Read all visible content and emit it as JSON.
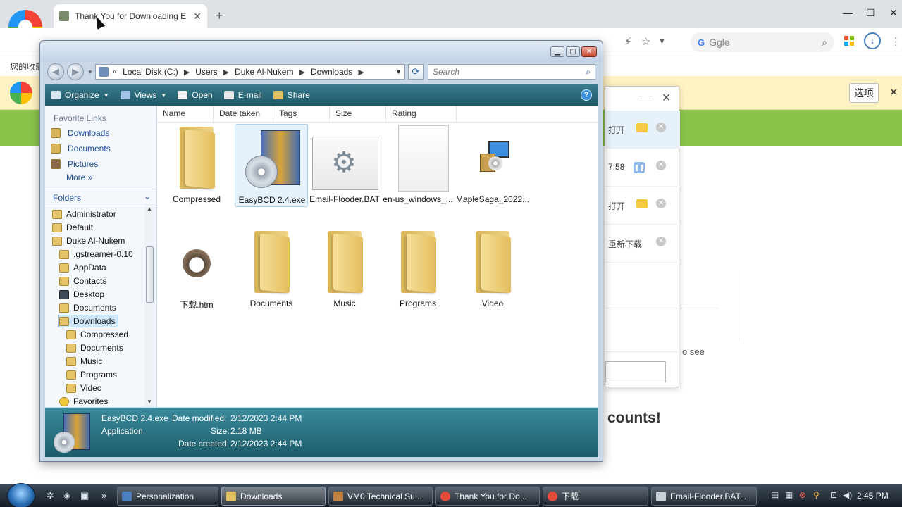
{
  "browser": {
    "tab_title": "Thank You for Downloading E",
    "tab_close": "✕",
    "new_tab": "+",
    "window_controls": {
      "min": "—",
      "max": "☐",
      "close": "✕"
    },
    "search_engine": "G",
    "search_placeholder": "Ggle",
    "bookmarks_text": "您的收藏",
    "infobar_button": "选项",
    "infobar_close": "✕",
    "page_heading": "counts!",
    "page_see": "o see",
    "download_panel": {
      "rows": [
        {
          "label": "打开",
          "action": "folder"
        },
        {
          "label": "7:58",
          "action": "pause"
        },
        {
          "label": "打开",
          "action": "folder"
        },
        {
          "label": "重新下载",
          "action": "none"
        }
      ]
    }
  },
  "explorer": {
    "nav": {
      "back": "◀",
      "forward": "▶"
    },
    "address": {
      "prefix": "«",
      "crumbs": [
        "Local Disk (C:)",
        "Users",
        "Duke Al-Nukem",
        "Downloads"
      ]
    },
    "search_placeholder": "Search",
    "commands": [
      {
        "label": "Organize",
        "icon": "organize-icon",
        "dropdown": true,
        "color": "#d8e6f2"
      },
      {
        "label": "Views",
        "icon": "views-icon",
        "dropdown": true,
        "color": "#9fc2e6"
      },
      {
        "label": "Open",
        "icon": "open-icon",
        "dropdown": false,
        "color": "#f3f3f3"
      },
      {
        "label": "E-mail",
        "icon": "email-icon",
        "dropdown": false,
        "color": "#e9e9e9"
      },
      {
        "label": "Share",
        "icon": "share-icon",
        "dropdown": false,
        "color": "#e0c060"
      }
    ],
    "help": "?",
    "favorite_links": {
      "title": "Favorite Links",
      "items": [
        "Downloads",
        "Documents",
        "Pictures"
      ],
      "more": "More  »"
    },
    "folders": {
      "title": "Folders",
      "tree": [
        {
          "label": "Administrator",
          "level": 1
        },
        {
          "label": "Default",
          "level": 1
        },
        {
          "label": "Duke Al-Nukem",
          "level": 1
        },
        {
          "label": ".gstreamer-0.10",
          "level": 2
        },
        {
          "label": "AppData",
          "level": 2
        },
        {
          "label": "Contacts",
          "level": 2
        },
        {
          "label": "Desktop",
          "level": 2
        },
        {
          "label": "Documents",
          "level": 2
        },
        {
          "label": "Downloads",
          "level": 2,
          "selected": true
        },
        {
          "label": "Compressed",
          "level": 3
        },
        {
          "label": "Documents",
          "level": 3
        },
        {
          "label": "Music",
          "level": 3
        },
        {
          "label": "Programs",
          "level": 3
        },
        {
          "label": "Video",
          "level": 3
        },
        {
          "label": "Favorites",
          "level": 2
        }
      ]
    },
    "columns": [
      "Name",
      "Date taken",
      "Tags",
      "Size",
      "Rating"
    ],
    "items": [
      {
        "label": "Compressed",
        "type": "folder"
      },
      {
        "label": "EasyBCD 2.4.exe",
        "type": "exe",
        "selected": true
      },
      {
        "label": "Email-Flooder.BAT",
        "type": "bat"
      },
      {
        "label": "en-us_windows_...",
        "type": "file"
      },
      {
        "label": "MapleSaga_2022...",
        "type": "setup"
      },
      {
        "label": "下载.htm",
        "type": "htm"
      },
      {
        "label": "Documents",
        "type": "folder"
      },
      {
        "label": "Music",
        "type": "folder"
      },
      {
        "label": "Programs",
        "type": "folder"
      },
      {
        "label": "Video",
        "type": "folder"
      }
    ],
    "details": {
      "name": "EasyBCD 2.4.exe",
      "type": "Application",
      "date_modified_label": "Date modified:",
      "date_modified": "2/12/2023 2:44 PM",
      "size_label": "Size:",
      "size": "2.18 MB",
      "date_created_label": "Date created:",
      "date_created": "2/12/2023 2:44 PM"
    }
  },
  "taskbar": {
    "buttons": [
      {
        "label": "Personalization",
        "color": "#4a7fc0"
      },
      {
        "label": "Downloads",
        "color": "#e0c060",
        "active": true
      },
      {
        "label": "VM0 Technical Su...",
        "color": "#c08040"
      },
      {
        "label": "Thank You for Do...",
        "color": "#e24a3a"
      },
      {
        "label": "下载",
        "color": "#e24a3a"
      },
      {
        "label": "Email-Flooder.BAT...",
        "color": "#c8d0d8"
      }
    ],
    "clock": "2:45 PM"
  }
}
